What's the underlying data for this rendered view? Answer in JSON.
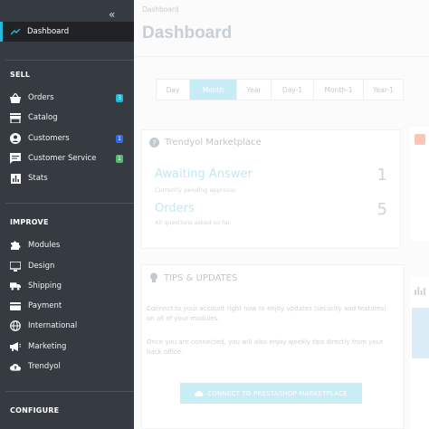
{
  "sidebar": {
    "collapse_glyph": "«",
    "active": {
      "label": "Dashboard",
      "icon": "trending-up-icon"
    },
    "sections": {
      "sell": "SELL",
      "improve": "IMPROVE",
      "configure": "CONFIGURE"
    },
    "sell_items": [
      {
        "label": "Orders",
        "icon": "shopping-basket-icon",
        "badge": "3"
      },
      {
        "label": "Catalog",
        "icon": "store-icon"
      },
      {
        "label": "Customers",
        "icon": "account-circle-icon",
        "badge": "1"
      },
      {
        "label": "Customer Service",
        "icon": "chat-icon",
        "badge": "1"
      },
      {
        "label": "Stats",
        "icon": "bar-chart-icon"
      }
    ],
    "improve_items": [
      {
        "label": "Modules",
        "icon": "puzzle-icon"
      },
      {
        "label": "Design",
        "icon": "desktop-icon"
      },
      {
        "label": "Shipping",
        "icon": "truck-icon"
      },
      {
        "label": "Payment",
        "icon": "credit-card-icon"
      },
      {
        "label": "International",
        "icon": "globe-icon"
      },
      {
        "label": "Marketing",
        "icon": "megaphone-icon"
      },
      {
        "label": "Trendyol",
        "icon": "cloud-upload-icon"
      }
    ]
  },
  "main": {
    "breadcrumb": "Dashboard",
    "title": "Dashboard",
    "periods": [
      "Day",
      "Month",
      "Year",
      "Day-1",
      "Month-1",
      "Year-1"
    ],
    "selected_period": "Month",
    "marketplace": {
      "title": "Trendyol Marketplace",
      "metrics": [
        {
          "label": "Awaiting Answer",
          "sub": "Currently pending approval",
          "value": "1"
        },
        {
          "label": "Orders",
          "sub": "All questions asked so far",
          "value": "5"
        }
      ]
    },
    "tips": {
      "title": "TIPS & UPDATES",
      "text1": "Connect to your account right now to enjoy updates (security and features) on all of your modules.",
      "text2": "Once you are connected, you will also enjoy weekly tips directly from your back office.",
      "cta": "CONNECT TO PRESTASHOP MARKETPLACE"
    }
  },
  "colors": {
    "sidebar_bg": "#363a41",
    "active_bg": "#202226",
    "accent": "#25b9d7",
    "badge_blue": "#2e6ae8",
    "badge_green": "#4fbe6f"
  }
}
